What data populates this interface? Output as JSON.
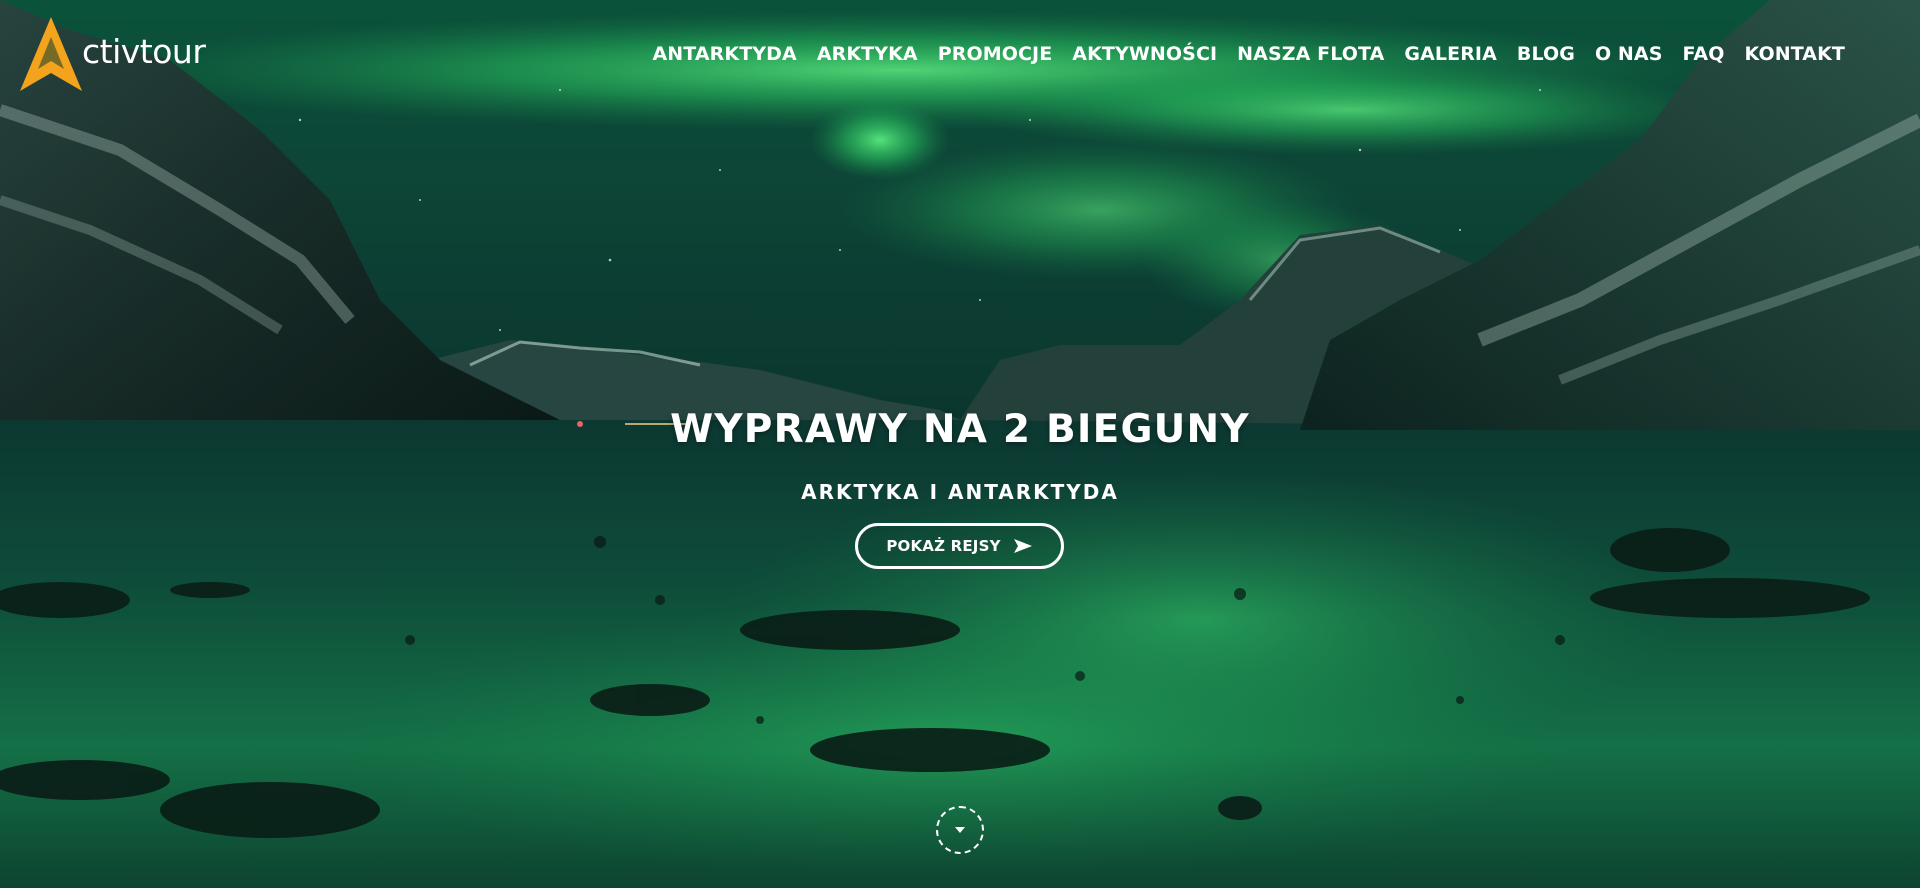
{
  "brand": {
    "logo_text": "ctivtour",
    "accent_color": "#f4a41c"
  },
  "nav": {
    "items": [
      {
        "label": "ANTARKTYDA"
      },
      {
        "label": "ARKTYKA"
      },
      {
        "label": "PROMOCJE"
      },
      {
        "label": "AKTYWNOŚCI"
      },
      {
        "label": "NASZA FLOTA"
      },
      {
        "label": "GALERIA"
      },
      {
        "label": "BLOG"
      },
      {
        "label": "O NAS"
      },
      {
        "label": "FAQ"
      },
      {
        "label": "KONTAKT"
      }
    ]
  },
  "hero": {
    "title": "WYPRAWY NA 2 BIEGUNY",
    "subtitle": "ARKTYKA I ANTARKTYDA",
    "cta_label": "POKAŻ REJSY",
    "cta_icon": "send-arrow-icon",
    "scroll_icon": "chevron-down-icon",
    "background": "aurora-over-fjord-photo"
  }
}
